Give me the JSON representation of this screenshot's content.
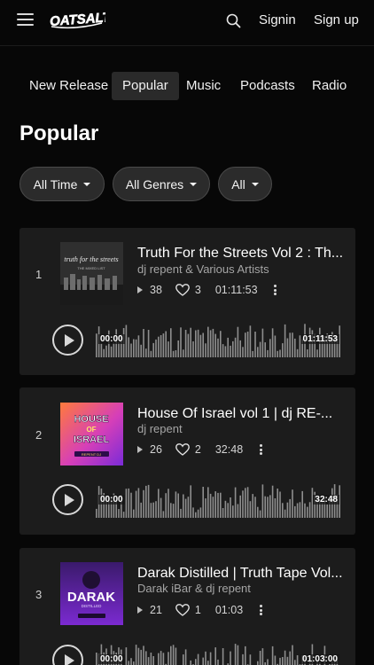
{
  "header": {
    "logo_text": "OATSALT",
    "signin_label": "Signin",
    "signup_label": "Sign up"
  },
  "tabs": [
    {
      "label": "New Release",
      "active": false
    },
    {
      "label": "Popular",
      "active": true
    },
    {
      "label": "Music",
      "active": false
    },
    {
      "label": "Podcasts",
      "active": false
    },
    {
      "label": "Radio",
      "active": false
    }
  ],
  "page_title": "Popular",
  "filters": [
    {
      "label": "All Time"
    },
    {
      "label": "All Genres"
    },
    {
      "label": "All"
    }
  ],
  "tracks": [
    {
      "rank": "1",
      "title": "Truth For the Streets Vol 2 : Th...",
      "artist": "dj repent & Various Artists",
      "plays": "38",
      "likes": "3",
      "duration": "01:11:53",
      "time_start": "00:00",
      "time_end": "01:11:53",
      "cover_text": "truth for the streets",
      "cover_color": "#3a3a3a"
    },
    {
      "rank": "2",
      "title": "House Of Israel vol 1 | dj RE-...",
      "artist": "dj repent",
      "plays": "26",
      "likes": "2",
      "duration": "32:48",
      "time_start": "00:00",
      "time_end": "32:48",
      "cover_text": "HOUSE OF ISRAEL",
      "cover_color": "#c23bd6"
    },
    {
      "rank": "3",
      "title": "Darak Distilled | Truth Tape Vol...",
      "artist": "Darak iBar & dj repent",
      "plays": "21",
      "likes": "1",
      "duration": "01:03",
      "time_start": "00:00",
      "time_end": "01:03:00",
      "cover_text": "DARAK",
      "cover_color": "#5a2a8f"
    }
  ],
  "colors": {
    "background": "#070707",
    "card": "#1c1c1c",
    "tab_active": "#2a2a2a",
    "waveform": "#8e8e8e"
  }
}
